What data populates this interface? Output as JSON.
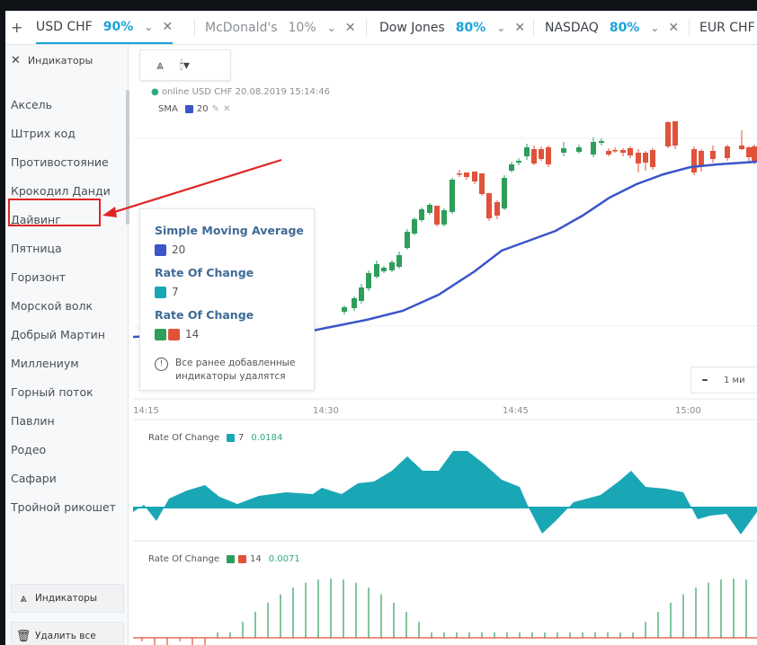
{
  "tabs": {
    "add_label": "+",
    "items": [
      {
        "name": "USD CHF",
        "percent": "90%",
        "active": true
      },
      {
        "name": "McDonald's",
        "percent": "10%",
        "active": false
      },
      {
        "name": "Dow Jones",
        "percent": "80%",
        "active": false
      },
      {
        "name": "NASDAQ",
        "percent": "80%",
        "active": false
      },
      {
        "name": "EUR CHF",
        "percent": "",
        "active": false
      }
    ]
  },
  "sidebar": {
    "title": "Индикаторы",
    "items": [
      "Аксель",
      "Штрих код",
      "Противостояние",
      "Крокодил Данди",
      "Дайвинг",
      "Пятница",
      "Горизонт",
      "Морской волк",
      "Добрый Мартин",
      "Миллениум",
      "Горный поток",
      "Павлин",
      "Родео",
      "Сафари",
      "Тройной рикошет"
    ],
    "highlighted_index": 4,
    "indicators_button": "Индикаторы",
    "delete_all_button": "Удалить все"
  },
  "chart": {
    "online_text": "online USD CHF 20.08.2019 15:14:46",
    "sma_label": "SMA",
    "sma_period": "20",
    "time_labels": [
      "14:15",
      "14:30",
      "14:45",
      "15:00"
    ],
    "zoom_label": "1 ми",
    "roc1_label": "Rate Of Change",
    "roc1_period": "7",
    "roc1_value": "0.0184",
    "roc2_label": "Rate Of Change",
    "roc2_period": "14",
    "roc2_value": "0.0071"
  },
  "tooltip": {
    "title1": "Simple Moving Average",
    "val1": "20",
    "title2": "Rate Of Change",
    "val2": "7",
    "title3": "Rate Of Change",
    "val3": "14",
    "note": "Все ранее добавленные индикаторы удалятся"
  },
  "colors": {
    "accent": "#1aa3d8",
    "bull": "#2e9e5b",
    "bear": "#e0523a",
    "sma": "#3b55c9",
    "roc": "#19a7b6",
    "highlight": "#e02424"
  }
}
